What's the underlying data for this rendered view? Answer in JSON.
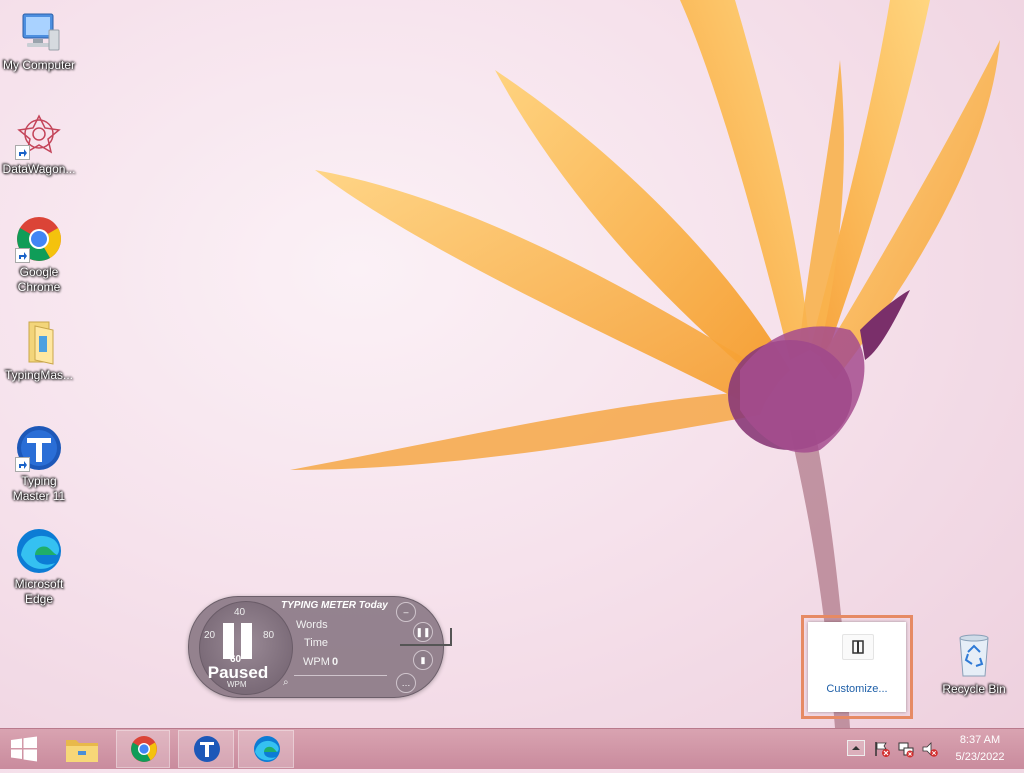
{
  "desktop": {
    "icons": [
      {
        "label": "My Computer",
        "icon": "computer-icon"
      },
      {
        "label": "DataWagon...",
        "icon": "datawagon-icon"
      },
      {
        "label": "Google Chrome",
        "icon": "chrome-icon"
      },
      {
        "label": "TypingMas...",
        "icon": "folder-icon"
      },
      {
        "label": "Typing Master 11",
        "icon": "typing-master-icon"
      },
      {
        "label": "Microsoft Edge",
        "icon": "edge-icon"
      },
      {
        "label": "Recycle Bin",
        "icon": "recycle-bin-icon"
      }
    ]
  },
  "typing_meter": {
    "title": "TYPING METER Today",
    "status": "Paused",
    "unit": "WPM",
    "gauge_ticks": [
      "20",
      "40",
      "60",
      "80"
    ],
    "rows": {
      "words_label": "Words",
      "time_label": "Time",
      "wpm_label": "WPM",
      "wpm_value": "0"
    }
  },
  "tray_popup": {
    "customize_label": "Customize..."
  },
  "taskbar": {
    "pinned": [
      "start-button",
      "file-explorer-icon",
      "chrome-icon",
      "typing-master-icon",
      "edge-icon"
    ],
    "clock": {
      "time": "8:37 AM",
      "date": "5/23/2022"
    }
  },
  "colors": {
    "taskbar": "#d29aaa",
    "accent_frame": "#e68a64",
    "link": "#1e5fa8"
  }
}
